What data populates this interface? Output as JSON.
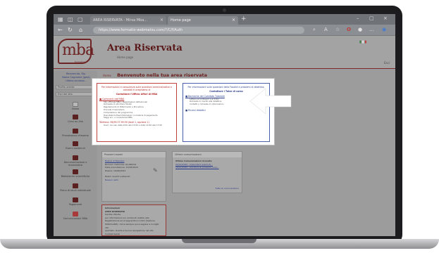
{
  "browser": {
    "tabs": [
      {
        "label": "AREA RISERVATA - Mirsa Mba..."
      },
      {
        "label": "Home page"
      }
    ],
    "url": "https://www.formatio-webmatsu.com/?/C/f/Auth"
  },
  "header": {
    "logo_text": "mba",
    "logo_sub": "formazione",
    "title": "Area Riservata",
    "subtitle": "Home page",
    "exit_label": "Esci"
  },
  "sidebar": {
    "user_lines": [
      "Benvenuto, Sig.",
      "Nome Cognome (gest)",
      "Ultimo accesso..."
    ],
    "buttons": [
      "Profilo utente",
      "Esci dal sito"
    ],
    "items": [
      {
        "label": "Home",
        "icon": "home-icon"
      },
      {
        "label": "Corsi on-line",
        "icon": "courses-icon"
      },
      {
        "label": "Prenotazioni d'esame",
        "icon": "exam-icon"
      },
      {
        "label": "Esami sostenuti",
        "icon": "exams-done-icon"
      },
      {
        "label": "Documentazione e modulistica",
        "icon": "documents-icon"
      },
      {
        "label": "Biblioteche scientifiche",
        "icon": "library-icon"
      },
      {
        "label": "Piano di studi individuale",
        "icon": "study-plan-icon"
      },
      {
        "label": "Pagamenti",
        "icon": "payments-icon"
      },
      {
        "label": "Comunicazioni MBA",
        "icon": "messages-icon"
      }
    ]
  },
  "main": {
    "home_link": "Home",
    "welcome": "Benvenuto nella tua area riservata"
  },
  "notice_left": {
    "intro": "Per informazioni e consulenza sulle questioni amministrative e contabili ti preghiamo di",
    "contact": "Contattare l'Ufficio Affari di MBA",
    "link1": "Commenti dell'MBA",
    "items": [
      "Sito ufficiale MBA / Registrazioni Istituzionali",
      "Richiesta di altri Piani Studio",
      "Regolamento di Riferimento e Procedure",
      "Procede il Calendario",
      "Compilazione del programma",
      "Prenotazioni Esami/Variazioni in materia di pagamento",
      "Saggi ecc. e consulenza MBA"
    ],
    "phone": "Telefono: 06/99.37.99.99 (tasti 1, opzione 1)",
    "hours": "Orari: lun-ven dalle 9:00 alle 13:00 e dalle 14:00 alle 17:00"
  },
  "notice_right": {
    "intro": "Per informazioni sulle questioni della Facoltà e problemi di didattica,",
    "contact": "Contattare i Tutor di corso",
    "intro2": "di corso",
    "link1": "Bacheche del Comitato Tutoriale",
    "items": [
      "Lettere ai professori e ai tutor",
      "Richieste in merito alla didattica",
      "Contatti e richieste di informazioni"
    ],
    "link2": "Ricorsi didattici"
  },
  "panel_exam": {
    "head": "Prossimi esami",
    "course": "Esame di Esempio",
    "rows": [
      {
        "label": "Numero matricola:",
        "value": "01/983/01"
      },
      {
        "label": "Data prenotazione:",
        "value": "15/05/2023"
      },
      {
        "label": "Esame:",
        "value": "19/06/2023"
      }
    ],
    "foot": "Esami recenti sostenuti:",
    "foot_item": "Nessun esito"
  },
  "panel_news": {
    "head": "Ultime comunicazioni",
    "sub": "Ultime Comunicazioni ricevute",
    "items": [
      "20/12/2022 - Calendario esami di...",
      "15/11/2022 - Iscrizioni ai prossimi corsi..."
    ],
    "more": "Tutte le comunicazioni"
  },
  "panel_info": {
    "head": "Informazioni",
    "lines": [
      "AREA RISERVATA",
      "Gentile Utente,",
      "per informazioni sui contenuti relativi alla",
      "Registrazione ed al seguente incontro (Sezione",
      "MODULARE), clicca sempre qui a seguire e rivolgiti allo",
      "sportello. Grazie e buona navigazione nel sito",
      "Cordiali Saluti"
    ]
  }
}
